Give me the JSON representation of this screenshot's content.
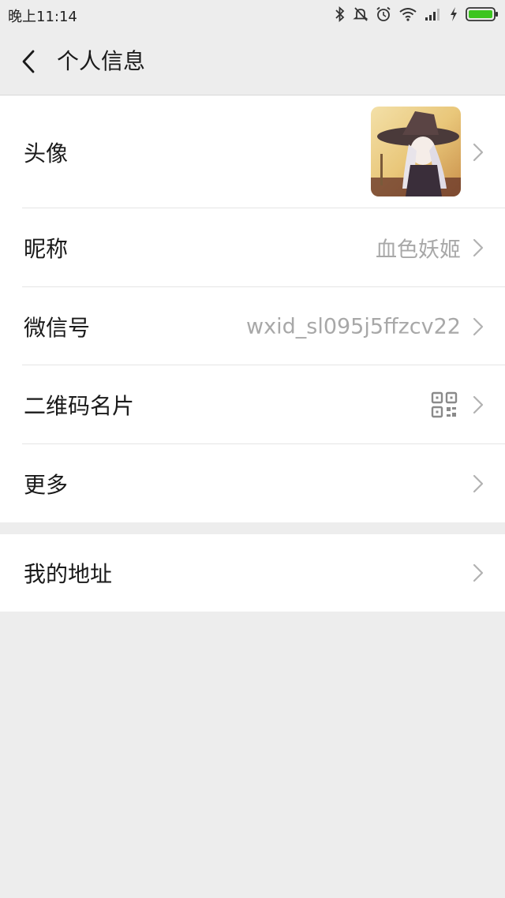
{
  "status": {
    "time": "晚上11:14"
  },
  "header": {
    "title": "个人信息"
  },
  "rows": {
    "avatar": {
      "label": "头像"
    },
    "nickname": {
      "label": "昵称",
      "value": "血色妖姬"
    },
    "wechat_id": {
      "label": "微信号",
      "value": "wxid_sl095j5ffzcv22"
    },
    "qr_card": {
      "label": "二维码名片"
    },
    "more": {
      "label": "更多"
    },
    "address": {
      "label": "我的地址"
    }
  },
  "icons": {
    "back": "chevron-left-icon",
    "row_arrow": "chevron-right-icon",
    "qr": "qr-code-icon"
  },
  "colors": {
    "background": "#ededed",
    "card": "#ffffff",
    "secondary_text": "#a8a8a8",
    "battery": "#3cc51f"
  }
}
